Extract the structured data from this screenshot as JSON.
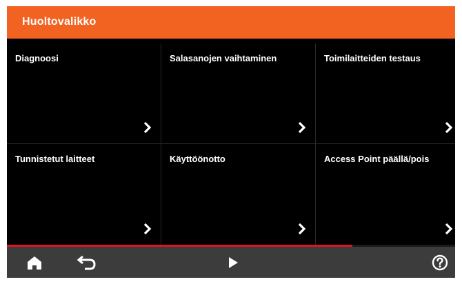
{
  "header": {
    "title": "Huoltovalikko"
  },
  "accent_color": "#f26322",
  "tiles": [
    {
      "label": "Diagnoosi",
      "icon": "chevron-right-icon"
    },
    {
      "label": "Salasanojen vaihtaminen",
      "icon": "chevron-right-icon"
    },
    {
      "label": "Toimilaitteiden testaus",
      "icon": "chevron-right-icon"
    },
    {
      "label": "Tunnistetut laitteet",
      "icon": "chevron-right-icon"
    },
    {
      "label": "Käyttöönotto",
      "icon": "chevron-right-icon"
    },
    {
      "label": "Access Point päällä/pois",
      "icon": "chevron-right-icon"
    }
  ],
  "progress": {
    "fraction": 0.77,
    "color": "#e0141e"
  },
  "bottom_bar": {
    "icons": [
      "home-icon",
      "back-icon",
      "play-icon",
      "help-icon"
    ]
  }
}
